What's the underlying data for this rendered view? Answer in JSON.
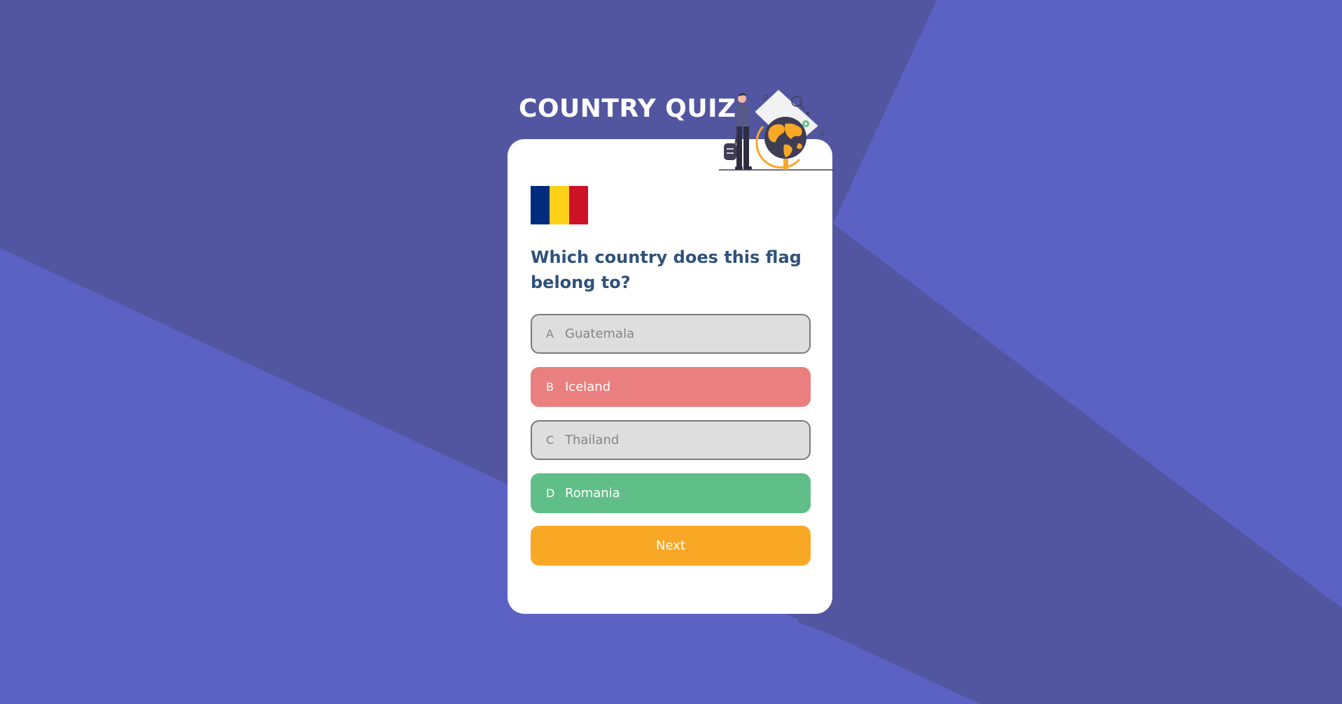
{
  "app": {
    "title": "COUNTRY QUIZ"
  },
  "colors": {
    "background": "#5c62c4",
    "background_shade": "#5256a0",
    "card": "#ffffff",
    "question_text": "#2f527b",
    "wrong": "#e97f7e",
    "correct": "#60bf88",
    "neutral_bg": "#dedede",
    "neutral_border": "#7a7a7a",
    "next": "#f9a826"
  },
  "illustration": {
    "icon": "traveler-with-globe-illustration"
  },
  "flag": {
    "icon": "romania-flag-icon",
    "stripes": [
      "#002b7f",
      "#fcd116",
      "#ce1126"
    ]
  },
  "question": {
    "text": "Which country does this flag belong to?"
  },
  "options": [
    {
      "letter": "A",
      "label": "Guatemala",
      "state": "neutral"
    },
    {
      "letter": "B",
      "label": "Iceland",
      "state": "wrong"
    },
    {
      "letter": "C",
      "label": "Thailand",
      "state": "neutral"
    },
    {
      "letter": "D",
      "label": "Romania",
      "state": "correct"
    }
  ],
  "next_button": {
    "label": "Next"
  }
}
